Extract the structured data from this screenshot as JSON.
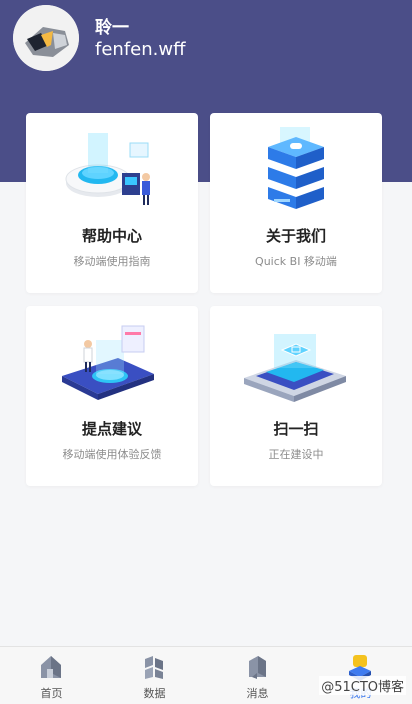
{
  "profile": {
    "name": "聆一",
    "account": "fenfen.wff"
  },
  "cards": [
    {
      "title": "帮助中心",
      "subtitle": "移动端使用指南"
    },
    {
      "title": "关于我们",
      "subtitle": "Quick BI 移动端"
    },
    {
      "title": "提点建议",
      "subtitle": "移动端使用体验反馈"
    },
    {
      "title": "扫一扫",
      "subtitle": "正在建设中"
    }
  ],
  "tabbar": {
    "items": [
      {
        "label": "首页",
        "icon": "home-icon"
      },
      {
        "label": "数据",
        "icon": "data-icon"
      },
      {
        "label": "消息",
        "icon": "message-icon"
      },
      {
        "label": "我的",
        "icon": "profile-icon",
        "active": true
      }
    ]
  },
  "watermark": "@51CTO博客",
  "colors": {
    "header": "#4b4e88",
    "accent": "#3e7bf0",
    "background": "#f5f6f8"
  }
}
